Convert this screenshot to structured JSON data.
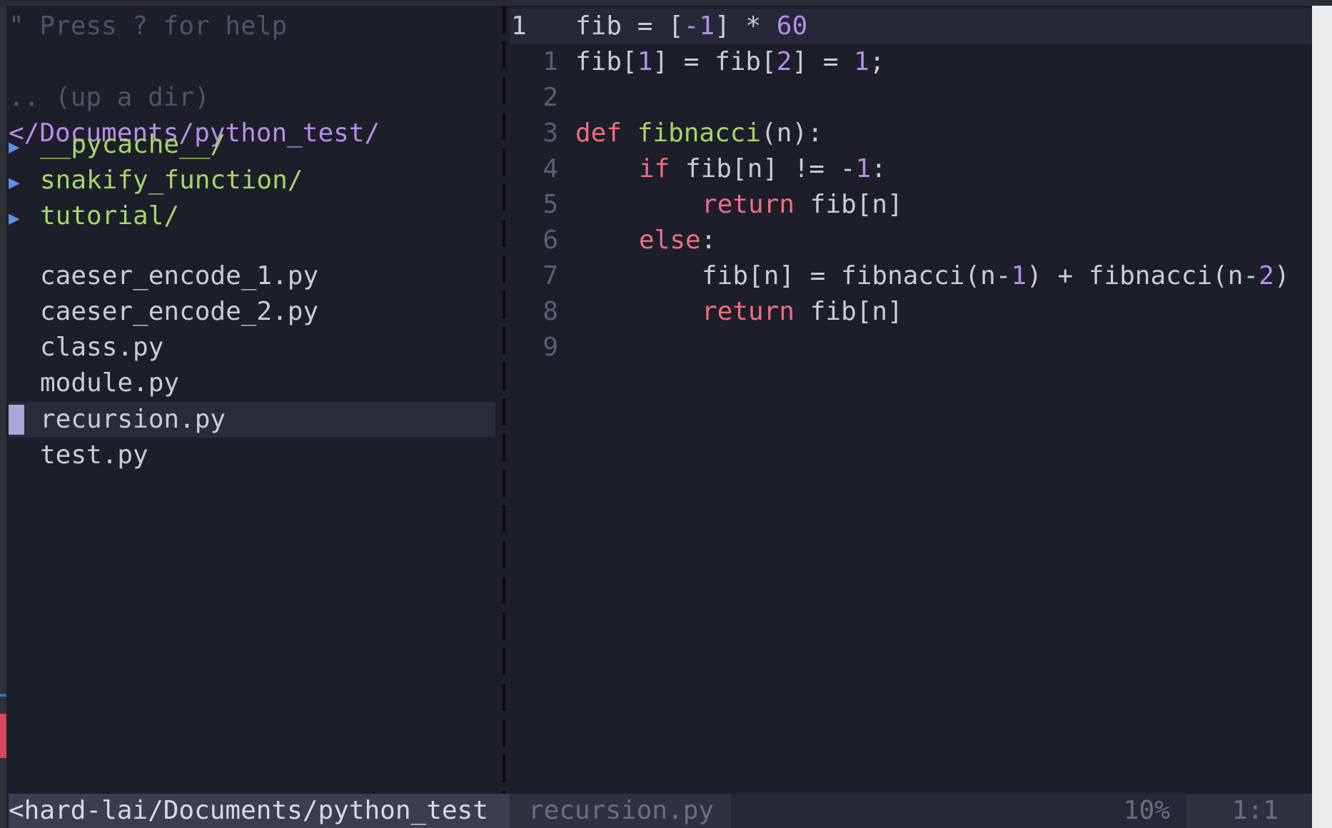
{
  "tree": {
    "help": "\" Press ? for help",
    "up": ".. (up a dir)",
    "root": "</Documents/python_test/",
    "arrow": "▶",
    "dirs": [
      "__pycache__/",
      "snakify_function/",
      "tutorial/"
    ],
    "files": [
      "caeser_encode_1.py",
      "caeser_encode_2.py",
      "class.py",
      "module.py",
      "recursion.py",
      "test.py"
    ],
    "selected_file": "recursion.py"
  },
  "editor": {
    "current_line_number": "1",
    "line_numbers": [
      "1",
      "2",
      "3",
      "4",
      "5",
      "6",
      "7",
      "8",
      "9"
    ],
    "line0": {
      "a": "fib = [",
      "b": "-1",
      "c": "] * ",
      "d": "60"
    },
    "line1": {
      "a": "fib[",
      "b": "1",
      "c": "] = fib[",
      "d": "2",
      "e": "] = ",
      "f": "1",
      "g": ";"
    },
    "line3": {
      "kw": "def",
      "fn": "fibnacci",
      "rest": "(n):"
    },
    "line4": {
      "kw": "if",
      "a": " fib[n] != -",
      "b": "1",
      "c": ":"
    },
    "line5": {
      "kw": "return",
      "rest": " fib[n]"
    },
    "line6": {
      "kw": "else",
      "rest": ":"
    },
    "line7": {
      "a": "fib[n] = fibnacci(n-",
      "b": "1",
      "c": ") + fibnacci(n-",
      "d": "2",
      "e": ")"
    },
    "line8": {
      "kw": "return",
      "rest": " fib[n]"
    }
  },
  "statusline": {
    "path": "<hard-lai/Documents/python_test",
    "file": "recursion.py",
    "percent": "10%",
    "position": "1:1"
  }
}
